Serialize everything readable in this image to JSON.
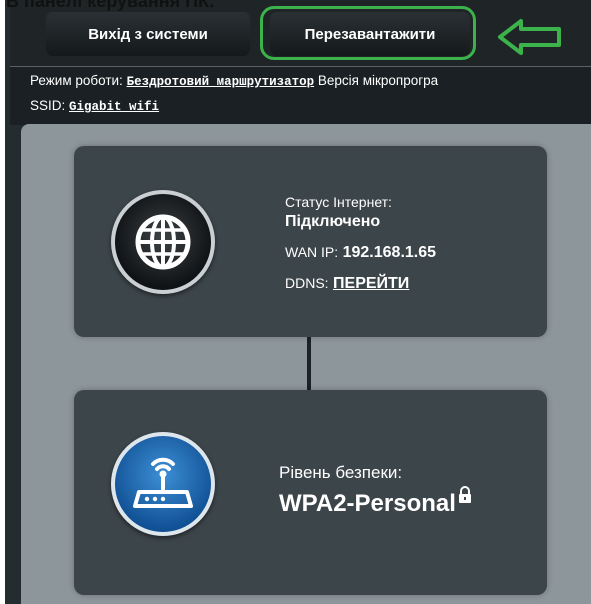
{
  "page": {
    "heading": "В панелі керування ПК:"
  },
  "top_bar": {
    "logout_label": "Вихід з системи",
    "reboot_label": "Перезавантажити"
  },
  "info_bar": {
    "mode_label": "Режим роботи:",
    "mode_value": "Бездротовий маршрутизатор",
    "firmware_label": "Версія мікропрогра",
    "ssid_label": "SSID:",
    "ssid_value": "Gigabit_wifi"
  },
  "internet_card": {
    "status_label": "Статус Інтернет:",
    "status_value": "Підключено",
    "wan_label": "WAN IP:",
    "wan_value": "192.168.1.65",
    "ddns_label": "DDNS:",
    "ddns_link": "ПЕРЕЙТИ",
    "icon": "globe-icon"
  },
  "wireless_card": {
    "security_label": "Рівень безпеки:",
    "security_value": "WPA2-Personal",
    "icon": "wireless-router-icon",
    "lock_icon": "lock-icon"
  },
  "colors": {
    "highlight": "#3bb34a",
    "panel_bg": "#8d969b",
    "card_bg": "#3c4549",
    "router_icon_blue": "#1f6fb8"
  }
}
